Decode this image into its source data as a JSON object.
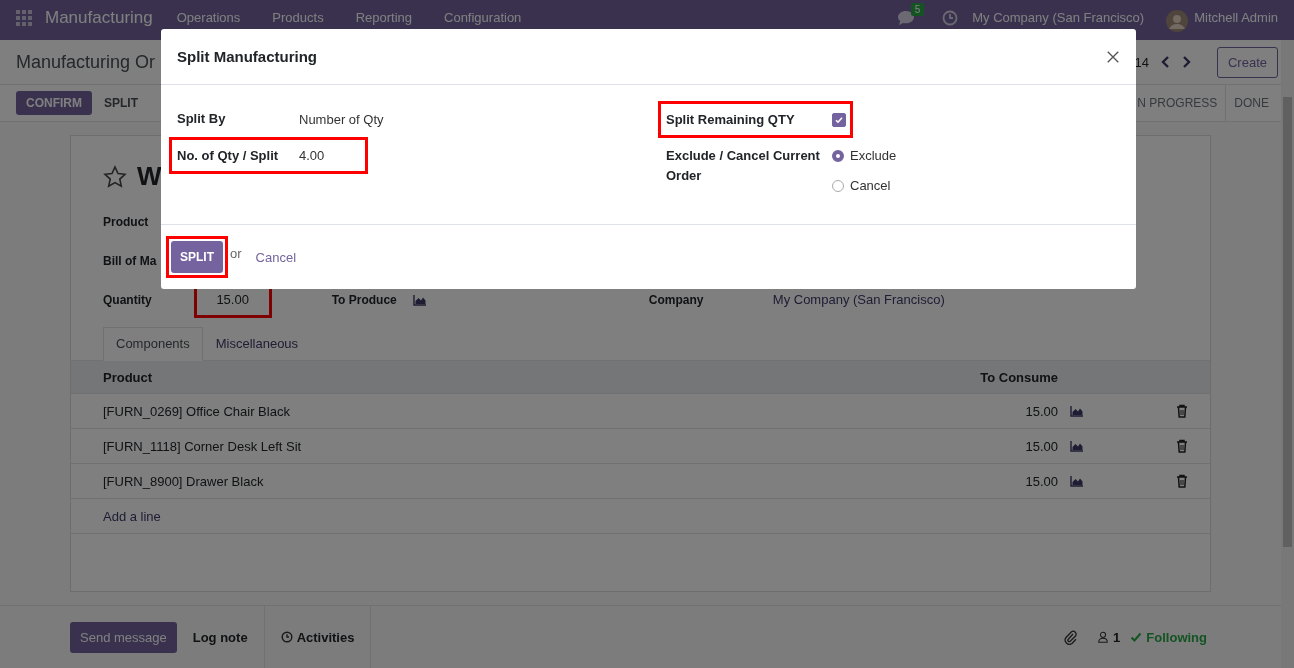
{
  "navbar": {
    "app_name": "Manufacturing",
    "menu": [
      "Operations",
      "Products",
      "Reporting",
      "Configuration"
    ],
    "message_count": "5",
    "company": "My Company (San Francisco)",
    "user": "Mitchell Admin"
  },
  "control_panel": {
    "breadcrumb": "Manufacturing Or",
    "pager": "14",
    "create_button": "Create",
    "action_buttons": [
      {
        "label": "CONFIRM",
        "primary": true
      },
      {
        "label": "SPLIT",
        "primary": false
      }
    ],
    "stages": [
      "N PROGRESS",
      "DONE"
    ]
  },
  "form": {
    "title": "W",
    "starred": false,
    "fields": [
      {
        "label": "Product"
      },
      {
        "label": "Bill of Ma"
      }
    ],
    "quantity": {
      "label": "Quantity",
      "value": "15.00",
      "highlighted": true
    },
    "to_produce_label": "To Produce",
    "company": {
      "label": "Company",
      "value": "My Company (San Francisco)"
    },
    "tabs": [
      {
        "label": "Components",
        "selected": true
      },
      {
        "label": "Miscellaneous",
        "selected": false
      }
    ],
    "table": {
      "columns": [
        "Product",
        "To Consume"
      ],
      "rows": [
        {
          "product": "[FURN_0269] Office Chair Black",
          "to_consume": "15.00"
        },
        {
          "product": "[FURN_1118] Corner Desk Left Sit",
          "to_consume": "15.00"
        },
        {
          "product": "[FURN_8900] Drawer Black",
          "to_consume": "15.00"
        }
      ],
      "add_line": "Add a line"
    }
  },
  "chatter": {
    "send_message": "Send message",
    "log_note": "Log note",
    "activities": "Activities",
    "followers": "1",
    "following": "Following"
  },
  "dialog": {
    "title": "Split Manufacturing",
    "split_by": {
      "label": "Split By",
      "value": "Number of Qty"
    },
    "qty_per_split": {
      "label": "No. of Qty / Split",
      "value": "4.00",
      "highlighted": true
    },
    "split_remaining": {
      "label": "Split Remaining QTY",
      "checked": true,
      "highlighted": true
    },
    "exclude_cancel": {
      "label": "Exclude / Cancel Current Order",
      "options": [
        {
          "label": "Exclude",
          "selected": true
        },
        {
          "label": "Cancel",
          "selected": false
        }
      ]
    },
    "split_button": {
      "label": "SPLIT",
      "highlighted": true
    },
    "or_text": "or",
    "cancel_link": "Cancel"
  }
}
